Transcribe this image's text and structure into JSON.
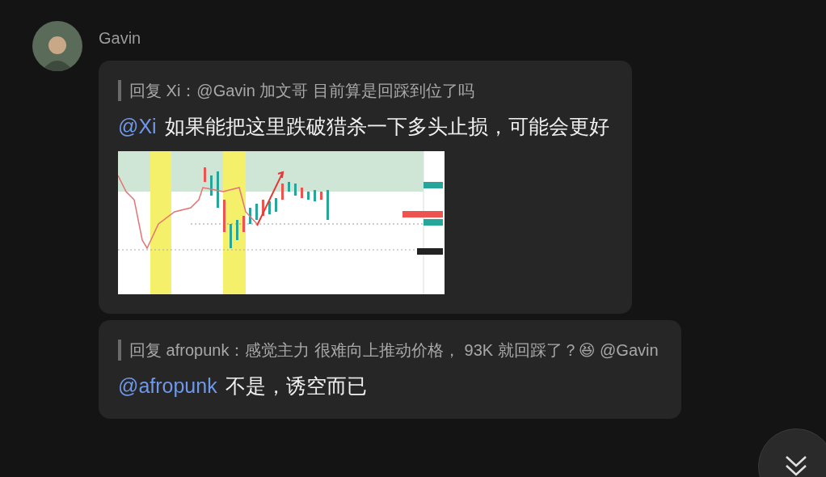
{
  "sender": {
    "name": "Gavin"
  },
  "messages": [
    {
      "reply": "回复 Xi：@Gavin 加文哥 目前算是回踩到位了吗",
      "mention": "@Xi",
      "text": "如果能把这里跌破猎杀一下多头止损，可能会更好",
      "attachment": {
        "kind": "chart"
      }
    },
    {
      "reply": "回复 afropunk：感觉主力 很难向上推动价格， 93K 就回踩了？😆 @Gavin",
      "mention": "@afropunk",
      "text": "不是，诱空而已"
    }
  ]
}
